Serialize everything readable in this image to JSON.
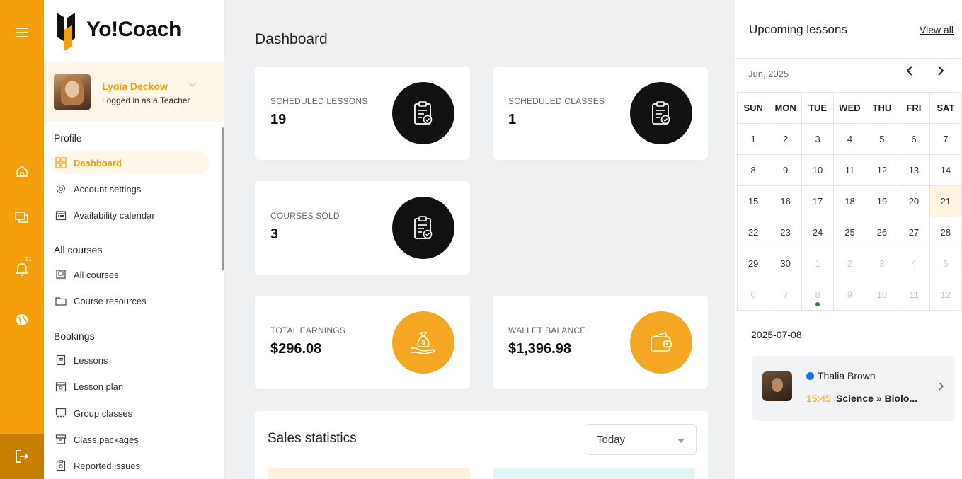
{
  "app": {
    "brand": "Yo!Coach",
    "notification_count": "51"
  },
  "user": {
    "name": "Lydia Deckow",
    "role": "Logged in as a Teacher"
  },
  "sidebar": {
    "sections": [
      {
        "title": "Profile"
      },
      {
        "title": "All courses"
      },
      {
        "title": "Bookings"
      }
    ],
    "items": [
      {
        "label": "Dashboard",
        "icon": "dashboard-icon"
      },
      {
        "label": "Account settings",
        "icon": "gear-icon"
      },
      {
        "label": "Availability calendar",
        "icon": "calendar-icon"
      },
      {
        "label": "All courses",
        "icon": "courses-icon"
      },
      {
        "label": "Course resources",
        "icon": "folder-icon"
      },
      {
        "label": "Lessons",
        "icon": "lessons-icon"
      },
      {
        "label": "Lesson plan",
        "icon": "lesson-plan-icon"
      },
      {
        "label": "Group classes",
        "icon": "group-classes-icon"
      },
      {
        "label": "Class packages",
        "icon": "packages-icon"
      },
      {
        "label": "Reported issues",
        "icon": "reported-issues-icon"
      }
    ]
  },
  "main": {
    "title": "Dashboard",
    "stats": [
      {
        "label": "SCHEDULED LESSONS",
        "value": "19"
      },
      {
        "label": "SCHEDULED CLASSES",
        "value": "1"
      },
      {
        "label": "COURSES SOLD",
        "value": "3"
      },
      {
        "label": "TOTAL EARNINGS",
        "value": "$296.08"
      },
      {
        "label": "WALLET BALANCE",
        "value": "$1,396.98"
      }
    ],
    "sales": {
      "title": "Sales statistics",
      "period": "Today"
    }
  },
  "upcoming": {
    "title": "Upcoming lessons",
    "view_all": "View all",
    "month": "Jun, 2025",
    "weekdays": [
      "SUN",
      "MON",
      "TUE",
      "WED",
      "THU",
      "FRI",
      "SAT"
    ],
    "weeks": [
      [
        "1",
        "2",
        "3",
        "4",
        "5",
        "6",
        "7"
      ],
      [
        "8",
        "9",
        "10",
        "11",
        "12",
        "13",
        "14"
      ],
      [
        "15",
        "16",
        "17",
        "18",
        "19",
        "20",
        "21"
      ],
      [
        "22",
        "23",
        "24",
        "25",
        "26",
        "27",
        "28"
      ],
      [
        "29",
        "30",
        "1",
        "2",
        "3",
        "4",
        "5"
      ],
      [
        "6",
        "7",
        "8",
        "9",
        "10",
        "11",
        "12"
      ]
    ],
    "selected_date": "2025-07-08",
    "lesson": {
      "teacher": "Thalia Brown",
      "time": "15:45",
      "subject": "Science » Biolo..."
    }
  },
  "colors": {
    "accent": "#f59e0b",
    "rail": "#f59e0b",
    "dark_circle": "#111111",
    "orange_circle": "#f5a623"
  }
}
